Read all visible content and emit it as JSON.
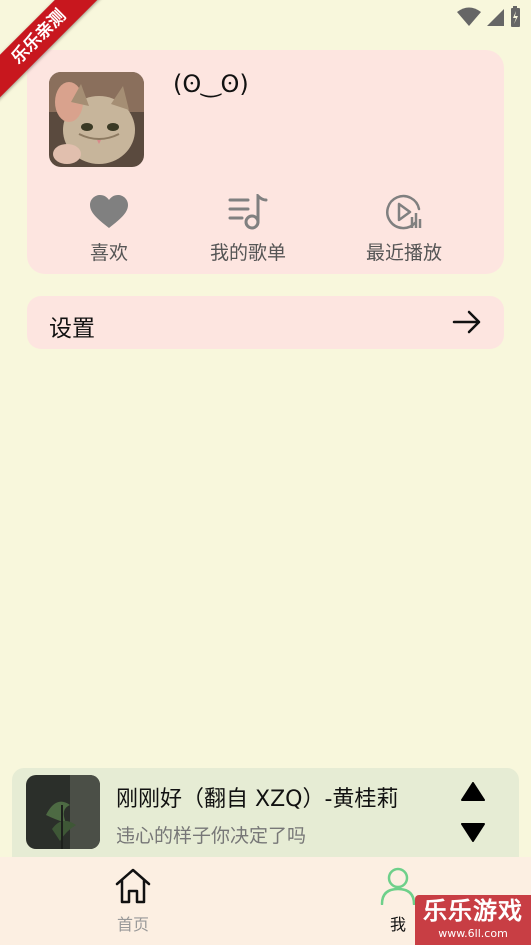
{
  "status_bar": {
    "icons": [
      "wifi-icon",
      "signal-icon",
      "battery-charging-icon"
    ]
  },
  "ribbon": {
    "text": "乐乐亲测"
  },
  "profile": {
    "nickname": "(ʘ‿ʘ)",
    "avatar": "cat-photo",
    "actions": [
      {
        "label": "喜欢",
        "icon": "heart-icon"
      },
      {
        "label": "我的歌单",
        "icon": "playlist-icon"
      },
      {
        "label": "最近播放",
        "icon": "recent-play-icon"
      }
    ]
  },
  "settings": {
    "label": "设置",
    "icon": "arrow-right-icon"
  },
  "player": {
    "title": "刚刚好（翻自 XZQ）-黄桂莉",
    "subtitle": "违心的样子你决定了吗",
    "controls": [
      "expand-up-icon",
      "collapse-down-icon"
    ]
  },
  "nav": {
    "items": [
      {
        "label": "首页",
        "icon": "home-icon",
        "active": false
      },
      {
        "label": "我",
        "icon": "user-icon",
        "active": true
      }
    ],
    "active_color": "#6ed08a",
    "inactive_color": "#999999"
  },
  "watermark": {
    "main": "乐乐游戏",
    "sub": "www.6ll.com"
  },
  "colors": {
    "background": "#f8f7dc",
    "card": "#fde5e0",
    "player_bg": "#e6ecd4",
    "nav_bg": "#fcefe2"
  }
}
